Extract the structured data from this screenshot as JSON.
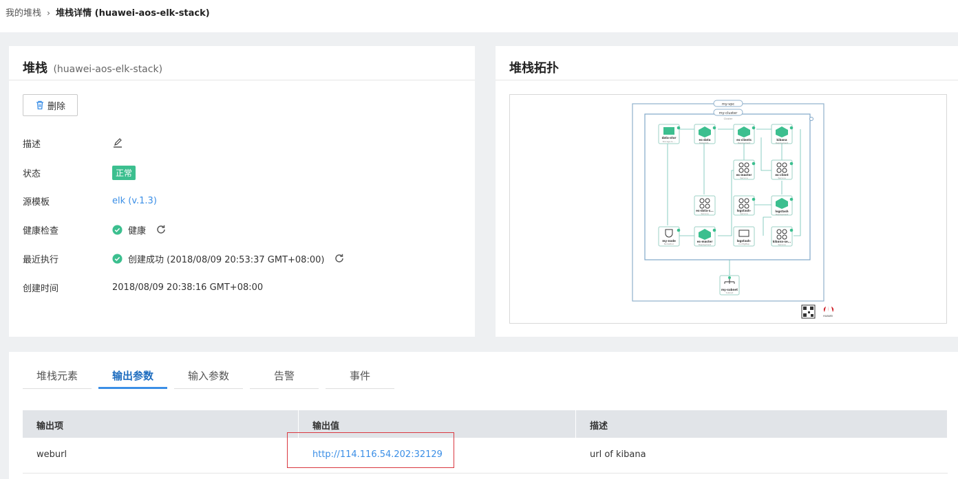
{
  "breadcrumb": {
    "parent": "我的堆栈",
    "separator": "›",
    "current": "堆栈详情 (huawei-aos-elk-stack)"
  },
  "info_card": {
    "title": "堆栈",
    "subtitle": "(huawei-aos-elk-stack)",
    "delete_label": "删除",
    "rows": {
      "description_label": "描述",
      "status_label": "状态",
      "status_value": "正常",
      "template_label": "源模板",
      "template_value": "elk (v.1.3)",
      "health_label": "健康检查",
      "health_value": "健康",
      "last_exec_label": "最近执行",
      "last_exec_value": "创建成功 (2018/08/09 20:53:37 GMT+08:00)",
      "created_label": "创建时间",
      "created_value": "2018/08/09 20:38:16 GMT+08:00"
    }
  },
  "topology_card": {
    "title": "堆栈拓扑",
    "vpc_label": "my-vpc",
    "cluster_label": "my-cluster",
    "cluster_type": "Cluster",
    "nodes": [
      {
        "name": "data-stor",
        "type": "Storage & ..."
      },
      {
        "name": "es-data",
        "type": "StatefulS..."
      },
      {
        "name": "es-clients",
        "type": "Deployment"
      },
      {
        "name": "kibana",
        "type": "Deployment"
      },
      {
        "name": "es-master",
        "type": "Service"
      },
      {
        "name": "es-client",
        "type": "Service"
      },
      {
        "name": "es-data-s...",
        "type": "Service"
      },
      {
        "name": "logstash-",
        "type": "Service"
      },
      {
        "name": "logstash",
        "type": "Deployment"
      },
      {
        "name": "my-node",
        "type": "NodePool"
      },
      {
        "name": "es-master",
        "type": "Deployment"
      },
      {
        "name": "logstash-",
        "type": "ConfigMap"
      },
      {
        "name": "kibana-se...",
        "type": "Service"
      },
      {
        "name": "my-subnet",
        "type": "Subnet"
      }
    ],
    "brand": "HUAWEI"
  },
  "tabs": {
    "elements": "堆栈元素",
    "outputs": "输出参数",
    "inputs": "输入参数",
    "alarms": "告警",
    "events": "事件"
  },
  "outputs_table": {
    "headers": {
      "item": "输出项",
      "value": "输出值",
      "description": "描述"
    },
    "rows": [
      {
        "item": "weburl",
        "value": "http://114.116.54.202:32129",
        "description": "url of kibana"
      }
    ]
  },
  "colors": {
    "accent": "#3a8ee6",
    "status_green": "#3cbf8f",
    "highlight_red": "#d9363e"
  }
}
